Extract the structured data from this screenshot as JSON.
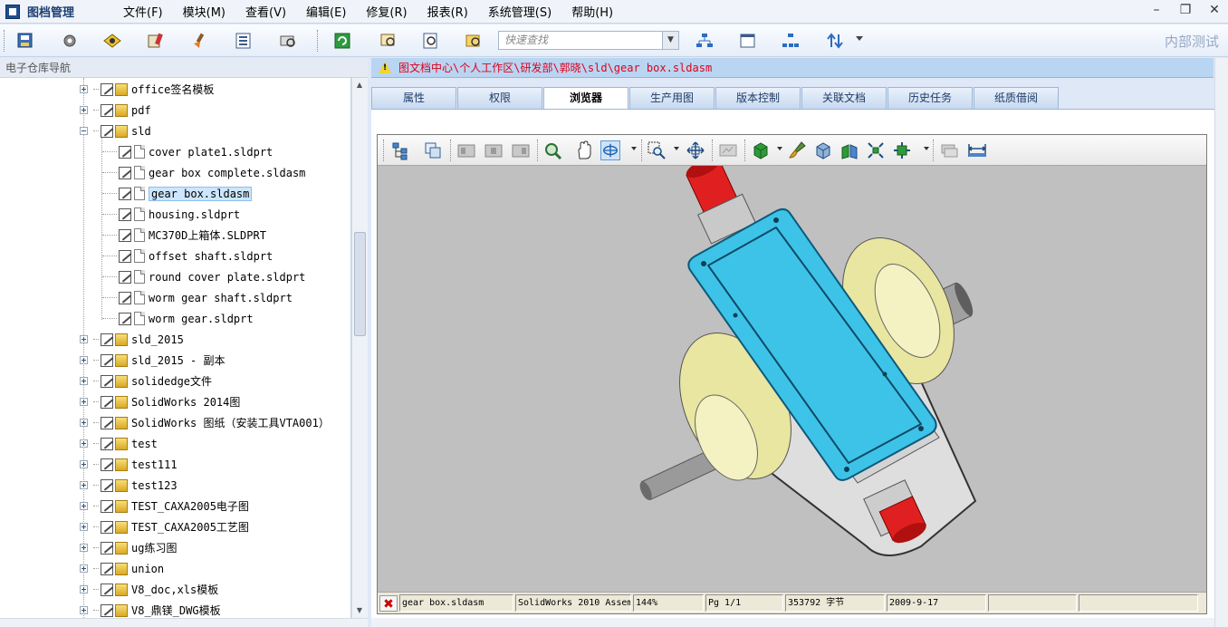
{
  "menu": {
    "app_title": "图档管理",
    "items": [
      "文件(F)",
      "模块(M)",
      "查看(V)",
      "编辑(E)",
      "修复(R)",
      "报表(R)",
      "系统管理(S)",
      "帮助(H)"
    ]
  },
  "toolbar": {
    "search_placeholder": "快速查找",
    "right_label": "内部测试"
  },
  "left_panel": {
    "header": "电子仓库导航"
  },
  "tree": {
    "top_items": [
      "office签名模板",
      "pdf",
      "sld"
    ],
    "sld_children": [
      "cover plate1.sldprt",
      "gear box complete.sldasm",
      "gear box.sldasm",
      "housing.sldprt",
      "MC370D上箱体.SLDPRT",
      "offset shaft.sldprt",
      "round cover plate.sldprt",
      "worm gear shaft.sldprt",
      "worm gear.sldprt"
    ],
    "bottom_items": [
      "sld_2015",
      "sld_2015 - 副本",
      "solidedge文件",
      "SolidWorks 2014图",
      "SolidWorks 图纸（安装工具VTA001）",
      "test",
      "test111",
      "test123",
      "TEST_CAXA2005电子图",
      "TEST_CAXA2005工艺图",
      "ug练习图",
      "union",
      "V8_doc,xls模板",
      "V8_鼎镁_DWG模板"
    ],
    "selected": "gear box.sldasm"
  },
  "path_bar": {
    "path": "图文档中心\\个人工作区\\研发部\\郭晓\\sld\\gear box.sldasm"
  },
  "tabs": [
    "属性",
    "权限",
    "浏览器",
    "生产用图",
    "版本控制",
    "关联文档",
    "历史任务",
    "纸质借阅"
  ],
  "active_tab": "浏览器",
  "status": {
    "file": "gear box.sldasm",
    "app": "SolidWorks 2010 Assem",
    "zoom": "144%",
    "page": "Pg 1/1",
    "size": "353792 字节",
    "date": "2009-9-17"
  },
  "colors": {
    "path_text": "#e0001a",
    "housing_cover": "#3ec3e8",
    "flange": "#e8e6a0",
    "shaft_end": "#e02020"
  }
}
